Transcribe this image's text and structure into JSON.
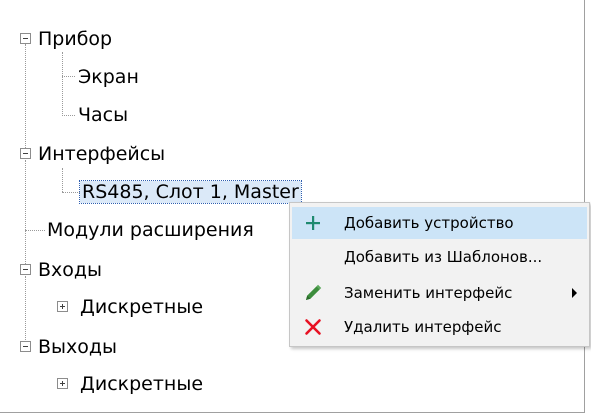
{
  "tree": {
    "items": [
      {
        "label": "Прибор",
        "expander": "minus"
      },
      {
        "label": "Экран"
      },
      {
        "label": "Часы"
      },
      {
        "label": "Интерфейсы",
        "expander": "minus"
      },
      {
        "label": "RS485, Слот 1, Master",
        "selected": true
      },
      {
        "label": "Модули расширения"
      },
      {
        "label": "Входы",
        "expander": "minus"
      },
      {
        "label": "Дискретные",
        "expander": "plus"
      },
      {
        "label": "Выходы",
        "expander": "minus"
      },
      {
        "label": "Дискретные",
        "expander": "plus"
      }
    ]
  },
  "context_menu": {
    "items": [
      {
        "label": "Добавить устройство",
        "icon": "plus-icon",
        "icon_color": "#1f8a70",
        "highlighted": true
      },
      {
        "label": "Добавить из Шаблонов...",
        "icon": null
      },
      {
        "label": "Заменить интерфейс",
        "icon": "pencil-icon",
        "icon_color": "#3c8d3c",
        "has_submenu": true
      },
      {
        "label": "Удалить интерфейс",
        "icon": "delete-x-icon",
        "icon_color": "#e81123"
      }
    ]
  },
  "colors": {
    "selection_bg": "#dbe9f8",
    "menu_hover_bg": "#cce4f7",
    "menu_bg": "#f2f2f2"
  }
}
